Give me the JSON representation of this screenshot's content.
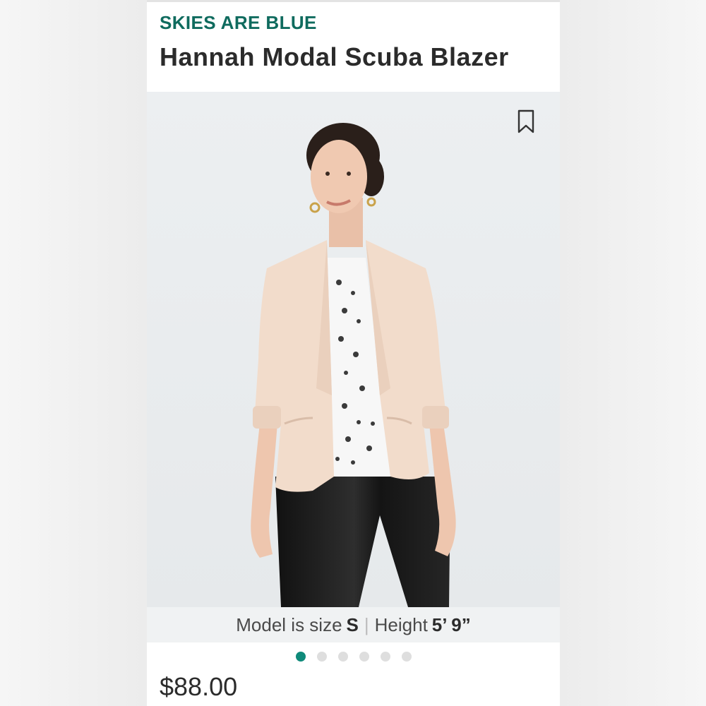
{
  "product": {
    "brand": "SKIES ARE BLUE",
    "title": "Hannah Modal Scuba Blazer",
    "price": "$88.00"
  },
  "image": {
    "bookmark_icon": "bookmark-icon",
    "caption": {
      "size_label": "Model is size",
      "size_value": "S",
      "separator": "|",
      "height_label": "Height",
      "height_value": "5’ 9”"
    }
  },
  "carousel": {
    "count": 6,
    "active_index": 0
  },
  "colors": {
    "brand": "#0f6b5e",
    "active_dot": "#0f8a7a",
    "blazer": "#f2dccb"
  }
}
